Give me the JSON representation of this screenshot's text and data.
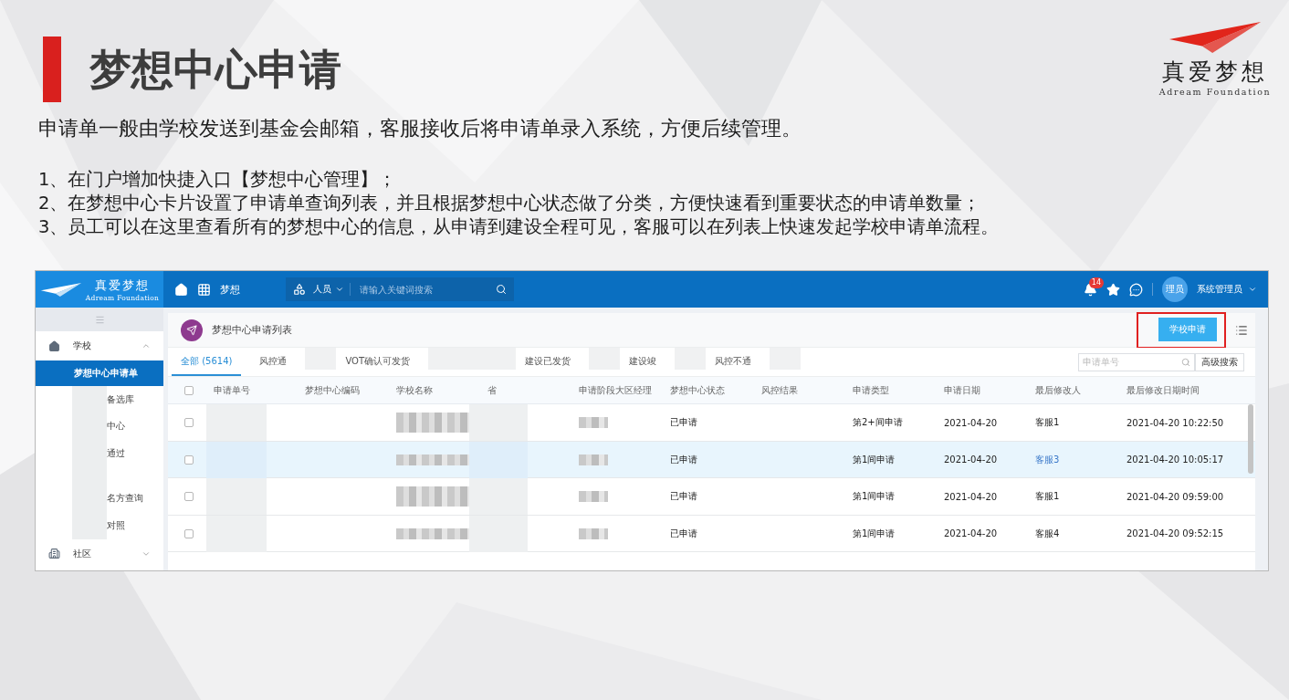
{
  "slide": {
    "title": "梦想中心申请",
    "logo": {
      "name": "真爱梦想",
      "tagline": "Adream Foundation"
    },
    "intro": "申请单一般由学校发送到基金会邮箱，客服接收后将申请单录入系统，方便后续管理。",
    "points": [
      "1、在门户增加快捷入口【梦想中心管理】；",
      "2、在梦想中心卡片设置了申请单查询列表，并且根据梦想中心状态做了分类，方便快速看到重要状态的申请单数量；",
      "3、员工可以在这里查看所有的梦想中心的信息，从申请到建设全程可见，客服可以在列表上快速发起学校申请单流程。"
    ]
  },
  "app": {
    "logo": {
      "name": "真爱梦想",
      "tagline": "Adream Foundation"
    },
    "nav": {
      "module": "梦想",
      "search": {
        "scope": "人员",
        "placeholder": "请输入关键词搜索"
      },
      "notifications": "14",
      "user": {
        "avatar": "理员",
        "name": "系统管理员"
      }
    },
    "sidebar": {
      "items": [
        {
          "label": "学校",
          "expanded": true,
          "children": [
            {
              "label": "梦想中心申请单",
              "selected": true,
              "kind": "plain"
            },
            {
              "label": "备选库",
              "selected": false,
              "kind": "covered"
            },
            {
              "label": "中心",
              "selected": false,
              "kind": "covered"
            },
            {
              "label": "通过",
              "selected": false,
              "kind": "covered"
            },
            {
              "label": "名方查询",
              "selected": false,
              "kind": "covered"
            },
            {
              "label": "对照",
              "selected": false,
              "kind": "covered"
            }
          ]
        },
        {
          "label": "社区",
          "expanded": false
        }
      ]
    },
    "page": {
      "title": "梦想中心申请列表",
      "action": "学校申请",
      "highlighted": true,
      "tabs": [
        {
          "label": "全部 (5614)",
          "selected": true
        },
        {
          "label": "风控通",
          "selected": false
        },
        {
          "label": "VOT确认可发货",
          "selected": false
        },
        {
          "label": "建设已发货",
          "selected": false
        },
        {
          "label": "建设竣",
          "selected": false
        },
        {
          "label": "风控不通",
          "selected": false
        }
      ],
      "search": {
        "placeholder": "申请单号"
      },
      "advanced": "高级搜索"
    },
    "table": {
      "select_all": false,
      "columns": [
        "申请单号",
        "梦想中心编码",
        "学校名称",
        "省",
        "申请阶段大区经理",
        "梦想中心状态",
        "风控结果",
        "申请类型",
        "申请日期",
        "最后修改人",
        "最后修改日期时间"
      ],
      "rows": [
        {
          "checked": false,
          "selected": false,
          "status": "已申请",
          "type": "第2+间申请",
          "date": "2021-04-20",
          "modifier": "客服1",
          "modified_at": "2021-04-20 10:22:50"
        },
        {
          "checked": false,
          "selected": true,
          "status": "已申请",
          "type": "第1间申请",
          "date": "2021-04-20",
          "modifier": "客服3",
          "modified_at": "2021-04-20 10:05:17"
        },
        {
          "checked": false,
          "selected": false,
          "status": "已申请",
          "type": "第1间申请",
          "date": "2021-04-20",
          "modifier": "客服1",
          "modified_at": "2021-04-20 09:59:00"
        },
        {
          "checked": false,
          "selected": false,
          "status": "已申请",
          "type": "第1间申请",
          "date": "2021-04-20",
          "modifier": "客服4",
          "modified_at": "2021-04-20 09:52:15"
        }
      ]
    }
  }
}
